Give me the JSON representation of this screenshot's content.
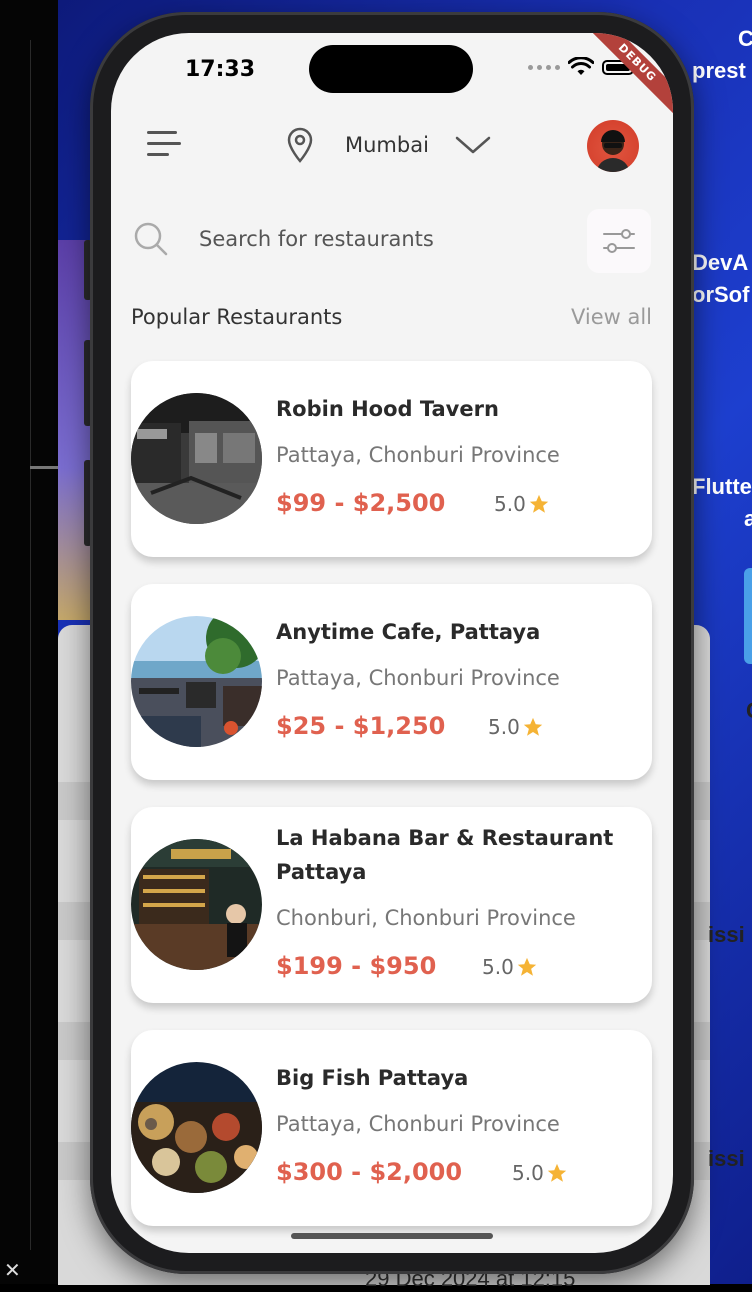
{
  "status_bar": {
    "time": "17:33",
    "debug_label": "DEBUG"
  },
  "header": {
    "location": "Mumbai"
  },
  "search": {
    "placeholder": "Search for restaurants"
  },
  "section": {
    "title": "Popular Restaurants",
    "view_all": "View all"
  },
  "restaurants": [
    {
      "name": "Robin Hood Tavern",
      "address": "Pattaya, Chonburi Province",
      "price": "$99 - $2,500",
      "rating": "5.0"
    },
    {
      "name": "Anytime Cafe, Pattaya",
      "address": "Pattaya, Chonburi Province",
      "price": "$25 - $1,250",
      "rating": "5.0"
    },
    {
      "name": "La Habana Bar & Restaurant Pattaya",
      "address": "Chonburi, Chonburi Province",
      "price": "$199 - $950",
      "rating": "5.0"
    },
    {
      "name": "Big Fish Pattaya",
      "address": "Pattaya, Chonburi Province",
      "price": "$300 - $2,000",
      "rating": "5.0"
    }
  ],
  "background": {
    "right_text": [
      "C",
      "prest",
      "DevA",
      "orSof",
      "Flutte",
      "a",
      "C",
      "issi",
      "issi"
    ],
    "bottom_text": "29 Dec 2024 at 12:15"
  },
  "colors": {
    "accent": "#e0614f",
    "star": "#f5b335",
    "avatar": "#d6432f"
  }
}
